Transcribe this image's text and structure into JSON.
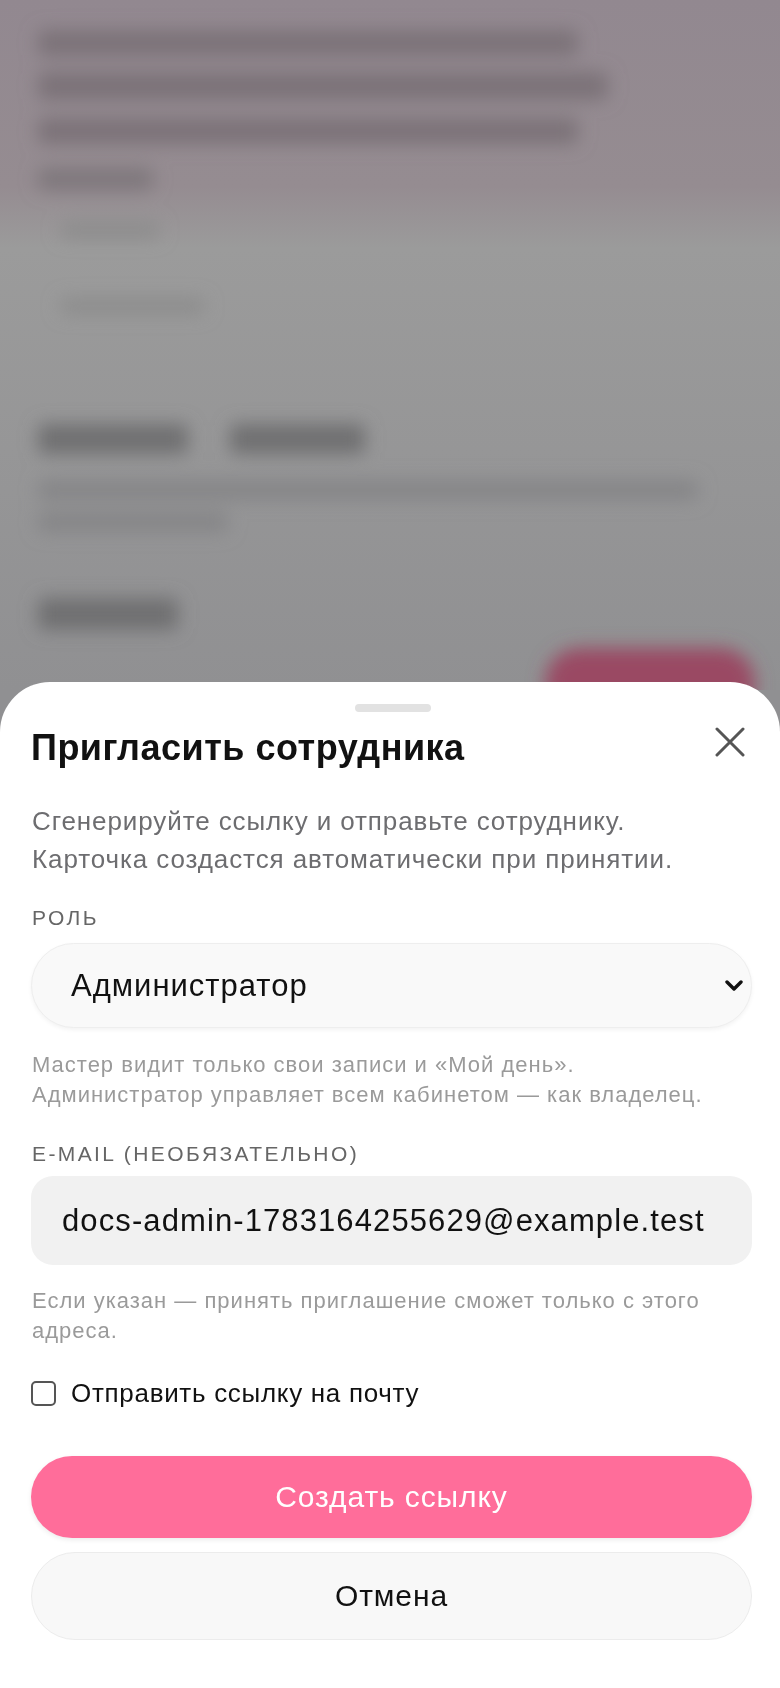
{
  "sheet": {
    "title": "Пригласить сотрудника",
    "description": "Сгенерируйте ссылку и отправьте сотруднику.\nКарточка создастся автоматически при принятии."
  },
  "role": {
    "label": "РОЛЬ",
    "value": "Администратор",
    "hint": "Мастер видит только свои записи и «Мой день».\nАдминистратор управляет всем кабинетом — как владелец."
  },
  "email": {
    "label": "E-MAIL (НЕОБЯЗАТЕЛЬНО)",
    "value": "docs-admin-1783164255629@example.test",
    "hint": "Если указан — принять приглашение сможет только с этого адреса."
  },
  "send_email": {
    "label": "Отправить ссылку на почту",
    "checked": false
  },
  "buttons": [
    {
      "label": "Создать ссылку",
      "kind": "primary"
    },
    {
      "label": "Отмена",
      "kind": "secondary"
    }
  ]
}
